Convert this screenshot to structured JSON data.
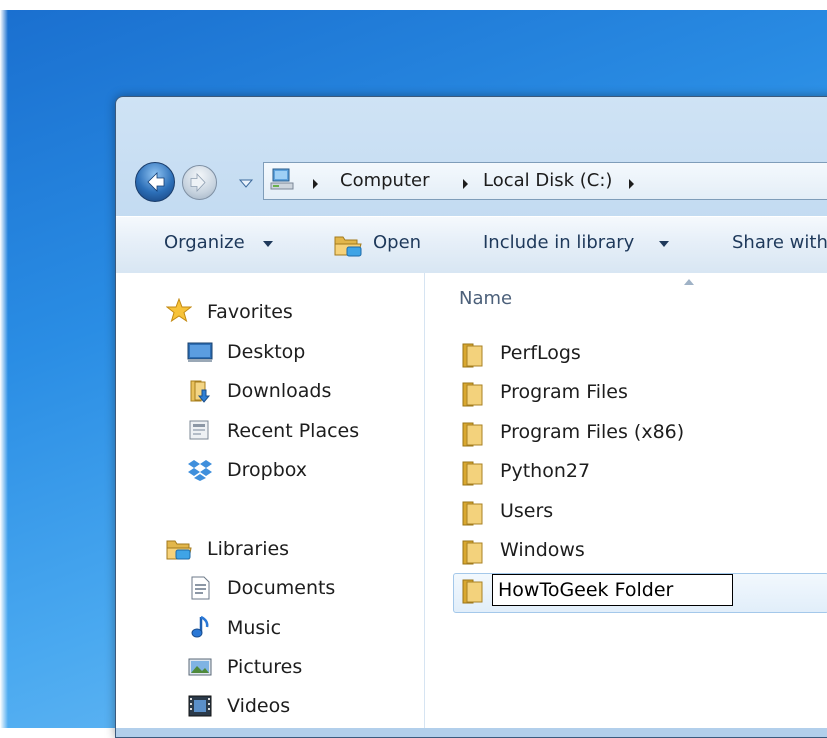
{
  "address_bar": {
    "breadcrumbs": [
      "Computer",
      "Local Disk (C:)"
    ]
  },
  "toolbar": {
    "organize_label": "Organize",
    "open_label": "Open",
    "include_label": "Include in library",
    "share_label": "Share with"
  },
  "sidebar": {
    "favorites": {
      "label": "Favorites",
      "items": [
        {
          "label": "Desktop",
          "icon": "desktop-icon"
        },
        {
          "label": "Downloads",
          "icon": "downloads-icon"
        },
        {
          "label": "Recent Places",
          "icon": "recent-places-icon"
        },
        {
          "label": "Dropbox",
          "icon": "dropbox-icon"
        }
      ]
    },
    "libraries": {
      "label": "Libraries",
      "items": [
        {
          "label": "Documents",
          "icon": "documents-icon"
        },
        {
          "label": "Music",
          "icon": "music-icon"
        },
        {
          "label": "Pictures",
          "icon": "pictures-icon"
        },
        {
          "label": "Videos",
          "icon": "videos-icon"
        }
      ]
    }
  },
  "file_list": {
    "column_name": "Name",
    "items": [
      "PerfLogs",
      "Program Files",
      "Program Files (x86)",
      "Python27",
      "Users",
      "Windows"
    ],
    "renaming": {
      "value": "HowToGeek Folder"
    }
  }
}
